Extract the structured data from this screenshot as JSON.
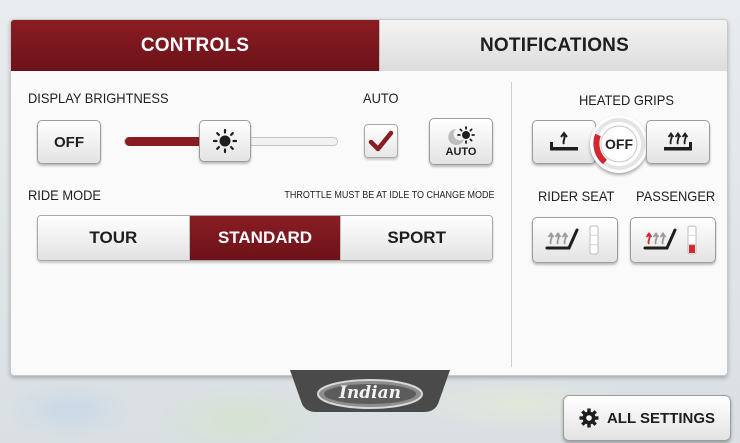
{
  "tabs": [
    {
      "label": "CONTROLS",
      "active": true
    },
    {
      "label": "NOTIFICATIONS",
      "active": false
    }
  ],
  "brightness": {
    "label": "DISPLAY BRIGHTNESS",
    "off_label": "OFF",
    "level": 0.38,
    "auto_label": "AUTO",
    "auto_checked": true,
    "auto_button_label": "AUTO"
  },
  "ride_mode": {
    "label": "RIDE MODE",
    "note": "THROTTLE MUST BE AT IDLE TO CHANGE MODE",
    "options": [
      "TOUR",
      "STANDARD",
      "SPORT"
    ],
    "selected": "STANDARD"
  },
  "heated_grips": {
    "label": "HEATED GRIPS",
    "dial_label": "OFF"
  },
  "seats": {
    "rider_label": "RIDER SEAT",
    "passenger_label": "PASSENGER",
    "rider_level": 0,
    "passenger_level": 0.33
  },
  "logo_text": "Indian",
  "all_settings_label": "ALL SETTINGS",
  "colors": {
    "accent": "#8a1d24",
    "heat_red": "#d4262e"
  },
  "icons": [
    "sun-icon",
    "moon-sun-auto-icon",
    "checkmark-icon",
    "heat-low-icon",
    "heat-high-icon",
    "seat-heat-icon",
    "gear-icon"
  ]
}
